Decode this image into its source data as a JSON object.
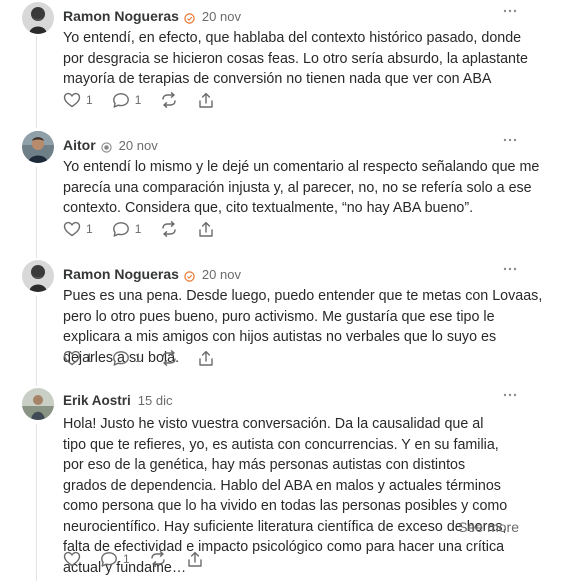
{
  "comments": [
    {
      "author": "Ramon Nogueras",
      "date": "20 nov",
      "badge": "verified-badge",
      "text": "Yo entendí, en efecto, que hablaba del contexto histórico pasado, donde por desgracia se hicieron cosas feas. Lo otro sería absurdo, la aplastante mayoría de terapias de conversión no tienen nada que ver con ABA",
      "likes": "1",
      "replies": "1"
    },
    {
      "author": "Aitor",
      "date": "20 nov",
      "badge": "subscriber-badge",
      "text": "Yo entendí lo mismo y le dejé un comentario al respecto señalando que me parecía una comparación injusta y, al parecer, no, no se refería solo a ese contexto. Considera que, cito textualmente, “no hay ABA bueno”.",
      "likes": "1",
      "replies": "1"
    },
    {
      "author": "Ramon Nogueras",
      "date": "20 nov",
      "badge": "verified-badge",
      "text": "Pues es una pena. Desde luego, puedo entender que te metas con Lovaas, pero lo otro pues bueno, puro activismo. Me gustaría que ese tipo le explicara a mis amigos con hijos autistas no verbales que lo suyo es dejarles a su bola.",
      "likes": "1",
      "replies": "1"
    },
    {
      "author": "Erik Aostri",
      "date": "15 dic",
      "text": "Hola! Justo he visto vuestra conversación. Da la causalidad que al tipo que te refieres, yo, es autista con concurrencias. Y en su familia, por eso de la genética, hay más personas autistas con distintos grados de dependencia. Hablo del ABA en malos y actuales términos como persona que lo ha vivido en todas las personas posibles y como neurocientífico. Hay suficiente literatura científica de exceso de horas, falta de efectividad e impacto psicológico como para hacer una crítica actual y fundame…",
      "see_more": "See more",
      "likes": "",
      "replies": "1"
    }
  ],
  "colors": {
    "badge_orange": "#e8742c",
    "icon_gray": "#6b6b6b",
    "text": "#292929"
  }
}
